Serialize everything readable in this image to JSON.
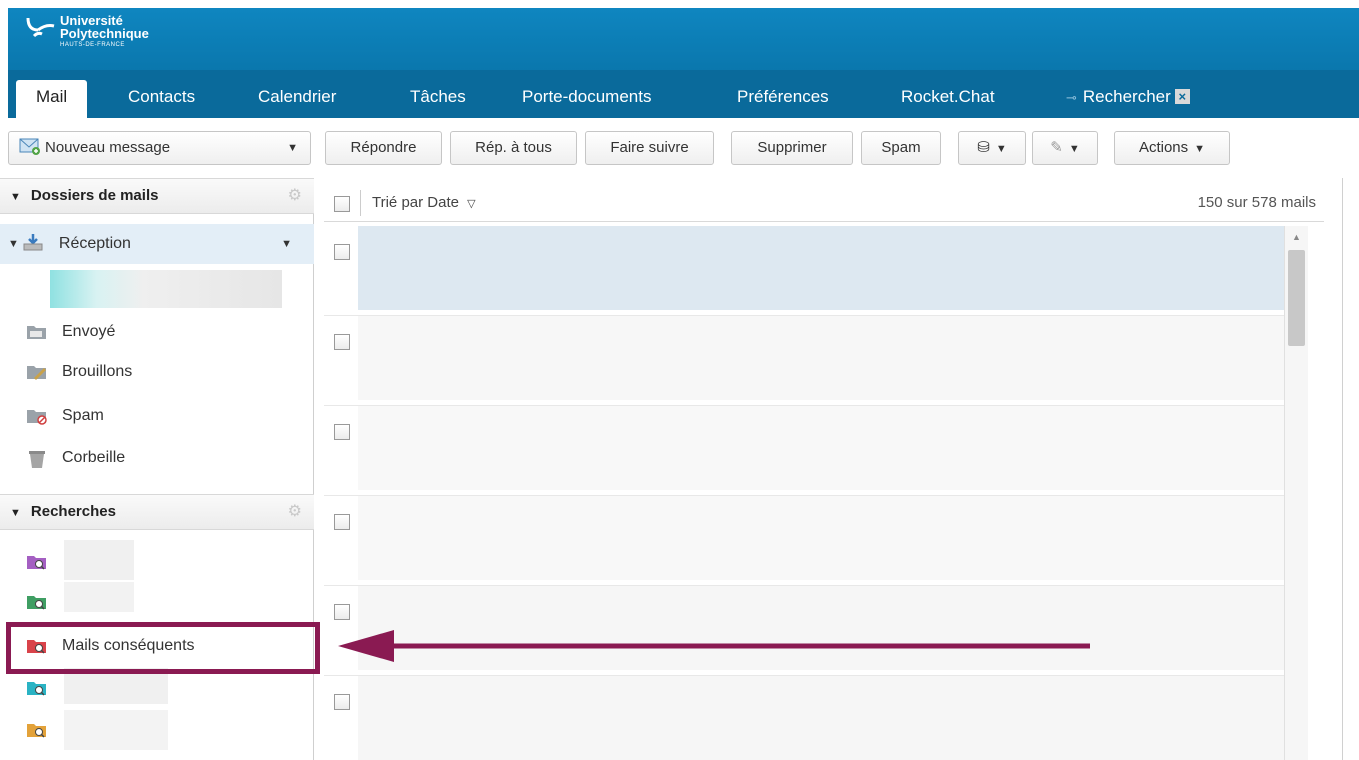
{
  "brand": {
    "line1": "Université",
    "line2": "Polytechnique",
    "line3": "HAUTS-DE-FRANCE"
  },
  "nav": {
    "tabs": [
      {
        "label": "Mail",
        "active": true
      },
      {
        "label": "Contacts"
      },
      {
        "label": "Calendrier"
      },
      {
        "label": "Tâches"
      },
      {
        "label": "Porte-documents"
      },
      {
        "label": "Préférences"
      },
      {
        "label": "Rocket.Chat"
      },
      {
        "label": "Rechercher"
      }
    ]
  },
  "toolbar": {
    "new_message": "Nouveau message",
    "reply": "Répondre",
    "reply_all": "Rép. à tous",
    "forward": "Faire suivre",
    "delete": "Supprimer",
    "spam": "Spam",
    "actions": "Actions"
  },
  "folders": {
    "header": "Dossiers de mails",
    "items": [
      {
        "label": "Réception",
        "icon": "inbox-icon",
        "selected": true
      },
      {
        "label": "Envoyé",
        "icon": "sent-folder-icon"
      },
      {
        "label": "Brouillons",
        "icon": "drafts-folder-icon"
      },
      {
        "label": "Spam",
        "icon": "spam-folder-icon"
      },
      {
        "label": "Corbeille",
        "icon": "trash-icon"
      }
    ]
  },
  "searches": {
    "header": "Recherches",
    "items": [
      {
        "label": "",
        "color": "#a45fc2"
      },
      {
        "label": "",
        "color": "#3f9e63"
      },
      {
        "label": "Mails conséquents",
        "color": "#d9434a"
      },
      {
        "label": "",
        "color": "#2ab3c4"
      },
      {
        "label": "",
        "color": "#e3a23a"
      }
    ]
  },
  "list": {
    "sort_label": "Trié par Date",
    "count_label": "150 sur 578 mails"
  },
  "colors": {
    "header_blue": "#0a77ad",
    "nav_blue": "#0a6a9b",
    "annotation": "#8a1a52"
  }
}
